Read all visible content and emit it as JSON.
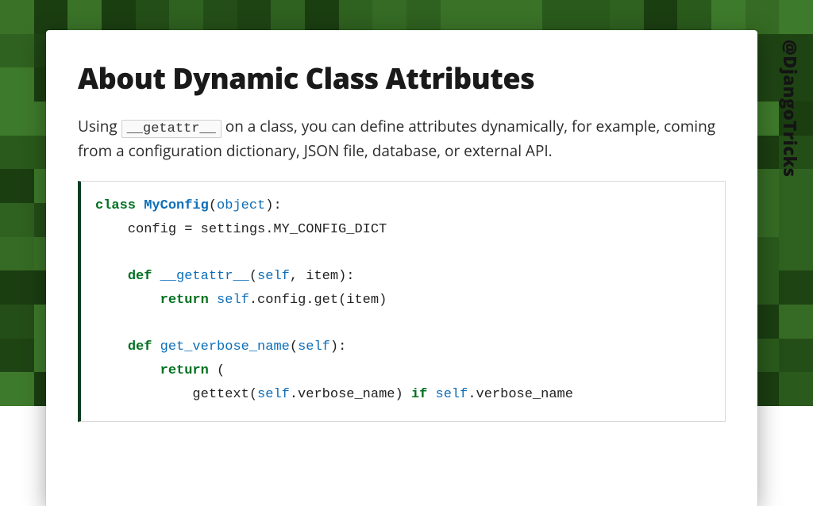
{
  "handle": "@DjangoTricks",
  "title": "About Dynamic Class Attributes",
  "lead": {
    "pre": "Using ",
    "code": "__getattr__",
    "post": " on a class, you can define attributes dynamically, for example, coming from a configuration dictionary, JSON file, database, or external API."
  },
  "code": {
    "kw_class": "class",
    "class_name": "MyConfig",
    "builtin_object": "object",
    "line_config": "    config = settings.MY_CONFIG_DICT",
    "kw_def1": "def",
    "fn_getattr": "__getattr__",
    "self": "self",
    "param_item": ", item):",
    "kw_return1": "return",
    "tail_return1": ".config.get(item)",
    "kw_def2": "def",
    "fn_verbose": "get_verbose_name",
    "paren_self_close": "):",
    "kw_return2": "return",
    "open_paren": " (",
    "line_last_pre": "            gettext(",
    "line_last_mid": ".verbose_name) ",
    "kw_if": "if",
    "line_last_post": ".verbose_name"
  },
  "bg_shades": [
    "#1f4414",
    "#2a5a1c",
    "#356b24",
    "#3e7a2b",
    "#244e17",
    "#2f6120",
    "#1b3e11",
    "#3a7228"
  ]
}
